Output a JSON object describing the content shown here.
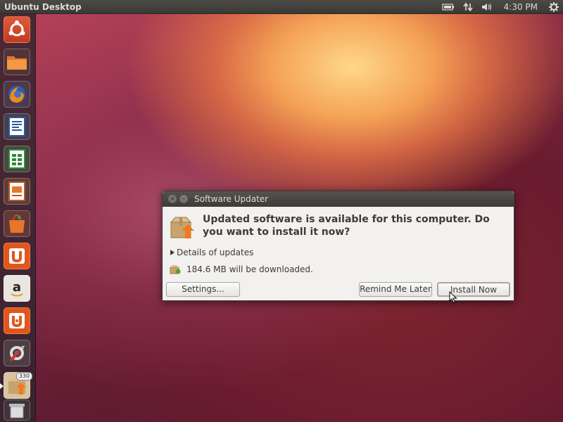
{
  "top_panel": {
    "title": "Ubuntu Desktop",
    "clock": "4:30 PM"
  },
  "launcher": {
    "items": [
      {
        "name": "dash-home",
        "icon": "ubuntu-logo-icon"
      },
      {
        "name": "files",
        "icon": "folder-icon"
      },
      {
        "name": "firefox",
        "icon": "firefox-icon"
      },
      {
        "name": "libreoffice-writer",
        "icon": "writer-icon"
      },
      {
        "name": "libreoffice-calc",
        "icon": "calc-icon"
      },
      {
        "name": "libreoffice-impress",
        "icon": "impress-icon"
      },
      {
        "name": "software-center",
        "icon": "shopping-bag-icon"
      },
      {
        "name": "ubuntu-one",
        "icon": "ubuntu-one-icon"
      },
      {
        "name": "amazon",
        "icon": "amazon-icon"
      },
      {
        "name": "ubuntu-one-music",
        "icon": "ubuntu-one-music-icon"
      },
      {
        "name": "system-settings",
        "icon": "settings-icon"
      },
      {
        "name": "software-updater",
        "icon": "updater-icon",
        "badge": "330"
      },
      {
        "name": "trash",
        "icon": "trash-icon"
      }
    ]
  },
  "dialog": {
    "title": "Software Updater",
    "headline": "Updated software is available for this computer. Do you want to install it now?",
    "details_label": "Details of updates",
    "download_text": "184.6 MB will be downloaded.",
    "settings_button": "Settings...",
    "remind_button": "Remind Me Later",
    "install_button": "Install Now"
  }
}
